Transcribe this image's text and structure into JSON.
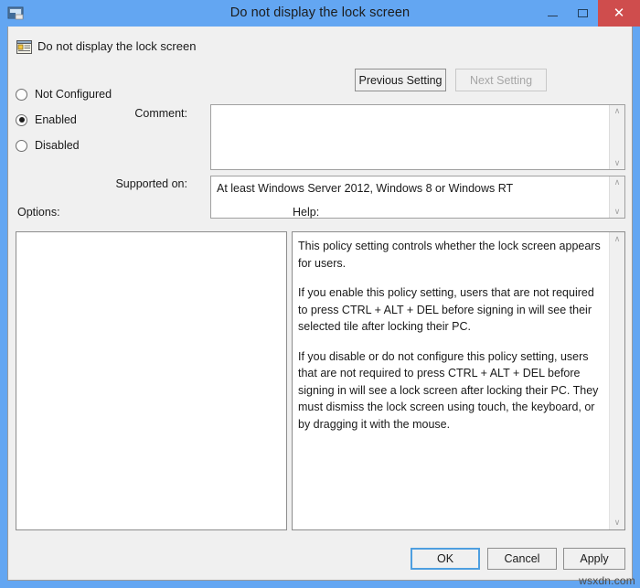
{
  "window": {
    "title": "Do not display the lock screen",
    "icon": "group-policy-icon",
    "controls": {
      "minimize": "–",
      "maximize": "□",
      "close": "✕"
    },
    "colors": {
      "titlebar": "#63a6f2",
      "close_button": "#cf4d4d",
      "client_background": "#f0f0f0",
      "panel_background": "#ffffff",
      "focus_border": "#4e9fe0"
    }
  },
  "header": {
    "policy_title": "Do not display the lock screen",
    "previous_setting_label": "Previous Setting",
    "next_setting_label": "Next Setting",
    "next_setting_disabled": true
  },
  "state_options": [
    {
      "label": "Not Configured",
      "selected": false
    },
    {
      "label": "Enabled",
      "selected": true
    },
    {
      "label": "Disabled",
      "selected": false
    }
  ],
  "fields": {
    "comment_label": "Comment:",
    "comment_value": "",
    "supported_on_label": "Supported on:",
    "supported_on_value": "At least Windows Server 2012, Windows 8 or Windows RT"
  },
  "panels": {
    "options_label": "Options:",
    "options_content": "",
    "help_label": "Help:",
    "help_paragraphs": [
      "This policy setting controls whether the lock screen appears for users.",
      "If you enable this policy setting, users that are not required to press CTRL + ALT + DEL before signing in will see their selected tile after  locking their PC.",
      "If you disable or do not configure this policy setting, users that are not required to press CTRL + ALT + DEL before signing in will see a lock screen after locking their PC. They must dismiss the lock screen using touch, the keyboard, or by dragging it with the mouse."
    ]
  },
  "footer": {
    "ok_label": "OK",
    "cancel_label": "Cancel",
    "apply_label": "Apply"
  },
  "watermark": "wsxdn.com",
  "scroll_glyphs": {
    "up": "∧",
    "down": "∨"
  }
}
